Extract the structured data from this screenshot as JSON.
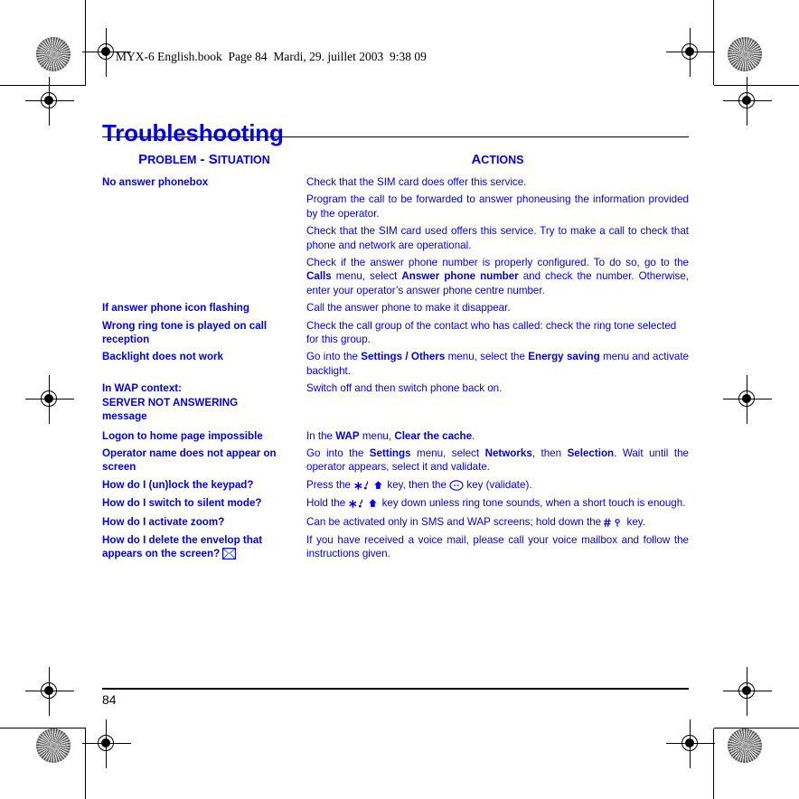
{
  "document": {
    "file_stamp": "MYX-6 English.book  Page 84  Mardi, 29. juillet 2003  9:38 09",
    "chapter_title": "Troubleshooting",
    "page_number": "84",
    "accent_color": "#0000EE",
    "text_color": "#000000"
  },
  "table": {
    "headers": {
      "problem": {
        "part1_cap": "P",
        "part1_rest": "ROBLEM",
        "separator": " - ",
        "part2_cap": "S",
        "part2_rest": "ITUATION"
      },
      "actions": {
        "cap": "A",
        "rest": "CTIONS"
      }
    },
    "rows": [
      {
        "problem": "No answer phonebox",
        "actions": [
          {
            "segments": [
              {
                "text": "Check that the SIM card does offer this service.",
                "bold": false
              }
            ]
          },
          {
            "segments": [
              {
                "text": "Program the call to be forwarded to answer phoneusing the information provided by the operator.",
                "bold": false
              }
            ]
          },
          {
            "segments": [
              {
                "text": "Check that the SIM card used offers this service. Try to make a call to check that phone and network are operational.",
                "bold": false
              }
            ]
          },
          {
            "segments": [
              {
                "text": "Check if the answer phone number is properly configured. To do so, go to the ",
                "bold": false
              },
              {
                "text": "Calls",
                "bold": true
              },
              {
                "text": " menu, select ",
                "bold": false
              },
              {
                "text": "Answer phone number",
                "bold": true
              },
              {
                "text": " and check the number. Otherwise, enter your operator’s answer phone centre number.",
                "bold": false
              }
            ]
          }
        ]
      },
      {
        "problem": "If answer phone icon flashing",
        "actions": [
          {
            "segments": [
              {
                "text": "Call the answer phone to make it disappear.",
                "bold": false
              }
            ]
          }
        ]
      },
      {
        "problem": "Wrong ring tone is played on call reception",
        "actions": [
          {
            "segments": [
              {
                "text": "Check the call group of the contact who has called: check the ring tone selected for this group.",
                "bold": false
              }
            ]
          }
        ]
      },
      {
        "problem": "Backlight does not work",
        "actions": [
          {
            "segments": [
              {
                "text": "Go into the ",
                "bold": false
              },
              {
                "text": "Settings / Others",
                "bold": true
              },
              {
                "text": " menu, select the ",
                "bold": false
              },
              {
                "text": "Energy saving",
                "bold": true
              },
              {
                "text": " menu and activate backlight.",
                "bold": false
              }
            ]
          }
        ]
      },
      {
        "problem": "In WAP context:",
        "problem_line2": "SERVER NOT ANSWERING",
        "problem_line3": "message",
        "actions": [
          {
            "segments": [
              {
                "text": "Switch off and then switch phone back on.",
                "bold": false
              }
            ]
          }
        ]
      },
      {
        "problem": "Logon to home page impossible",
        "actions": [
          {
            "segments": [
              {
                "text": "In the ",
                "bold": false
              },
              {
                "text": "WAP",
                "bold": true
              },
              {
                "text": " menu, ",
                "bold": false
              },
              {
                "text": "Clear the cache",
                "bold": true
              },
              {
                "text": ".",
                "bold": false
              }
            ]
          }
        ]
      },
      {
        "problem": "Operator name does not appear on screen",
        "actions": [
          {
            "segments": [
              {
                "text": "Go into the ",
                "bold": false
              },
              {
                "text": "Settings",
                "bold": true
              },
              {
                "text": " menu, select ",
                "bold": false
              },
              {
                "text": "Networks",
                "bold": true
              },
              {
                "text": ", then ",
                "bold": false
              },
              {
                "text": "Selection",
                "bold": true
              },
              {
                "text": ". Wait until the operator appears, select it and validate.",
                "bold": false
              }
            ]
          }
        ]
      },
      {
        "problem": "How do I (un)lock the keypad?",
        "actions": [
          {
            "prefix": "Press the ",
            "icon1": "star-shift-key-icon",
            "middle": " key, then the ",
            "icon2": "validate-key-icon",
            "suffix": " key (validate)."
          }
        ]
      },
      {
        "problem": "How do I switch to silent mode?",
        "actions": [
          {
            "prefix": "Hold the ",
            "icon1": "star-shift-key-icon",
            "suffix_long": " key down unless ring tone sounds, when a short touch is enough."
          }
        ]
      },
      {
        "problem": "How do I activate zoom?",
        "actions": [
          {
            "prefix_zoom": "Can be activated only in SMS and WAP screens; hold down the ",
            "icon_hash": "hash-zoom-key-icon",
            "suffix_zoom": " key."
          }
        ]
      },
      {
        "problem": "How do I delete the envelop that appears on the screen?",
        "problem_icon": "envelope-icon",
        "actions": [
          {
            "segments": [
              {
                "text": "If you have received a voice mail, please call your voice mailbox and follow the instructions given.",
                "bold": false
              }
            ]
          }
        ]
      }
    ]
  }
}
